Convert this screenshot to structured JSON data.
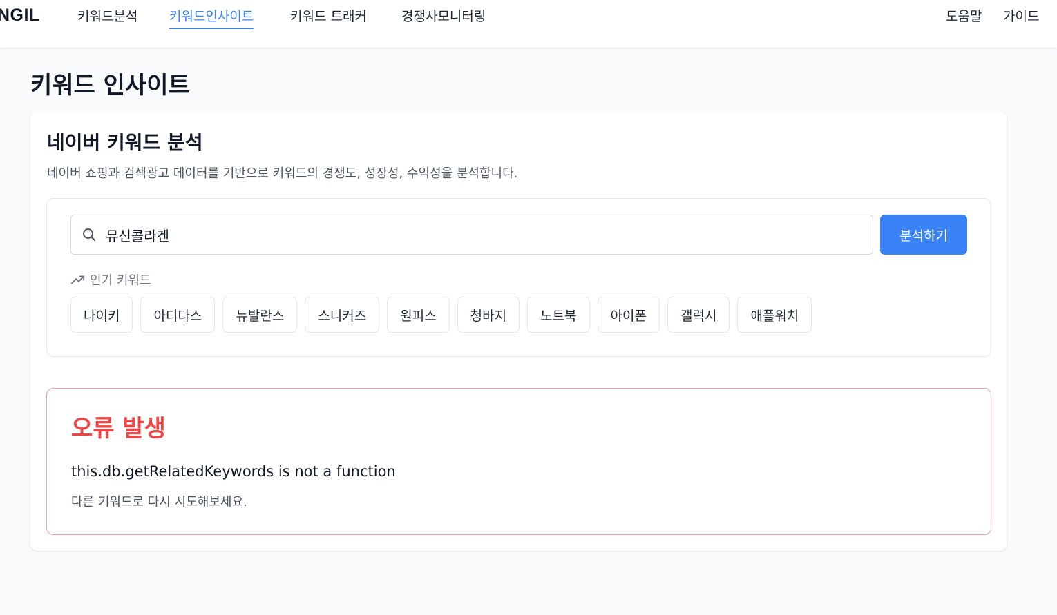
{
  "header": {
    "logo": "NGIL",
    "nav": [
      {
        "label": "키워드분석",
        "active": false
      },
      {
        "label": "키워드인사이트",
        "active": true
      },
      {
        "label": "키워드 트래커",
        "active": false
      },
      {
        "label": "경쟁사모니터링",
        "active": false
      }
    ],
    "right_links": [
      "도움말",
      "가이드"
    ]
  },
  "page": {
    "title": "키워드 인사이트"
  },
  "card": {
    "title": "네이버 키워드 분석",
    "description": "네이버 쇼핑과 검색광고 데이터를 기반으로 키워드의 경쟁도, 성장성, 수익성을 분석합니다.",
    "search": {
      "value": "뮤신콜라겐",
      "button_label": "분석하기"
    },
    "popular": {
      "label": "인기 키워드",
      "keywords": [
        "나이키",
        "아디다스",
        "뉴발란스",
        "스니커즈",
        "원피스",
        "청바지",
        "노트북",
        "아이폰",
        "갤럭시",
        "애플워치"
      ]
    },
    "error": {
      "title": "오류 발생",
      "message": "this.db.getRelatedKeywords is not a function",
      "hint": "다른 키워드로 다시 시도해보세요."
    }
  },
  "colors": {
    "accent": "#3b82f6",
    "error": "#ef4444",
    "error_border": "#f0a0a0"
  }
}
